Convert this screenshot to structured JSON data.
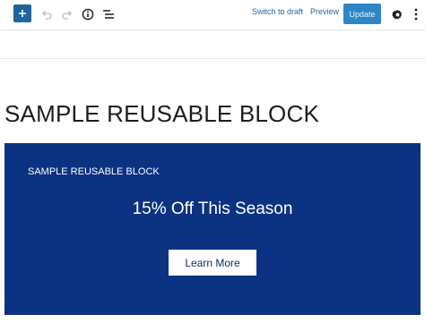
{
  "toolbar": {
    "add_icon": "plus-icon",
    "undo_icon": "undo-icon",
    "redo_icon": "redo-icon",
    "info_icon": "info-icon",
    "outline_icon": "list-view-icon",
    "switch_to_draft_label": "Switch to draft",
    "preview_label": "Preview",
    "update_label": "Update",
    "settings_icon": "gear-icon",
    "more_icon": "more-vertical-icon",
    "colors": {
      "accent": "#1e64a0",
      "update_bg": "#2c86c8"
    }
  },
  "editor": {
    "title": "SAMPLE REUSABLE BLOCK",
    "banner": {
      "label": "SAMPLE REUSABLE BLOCK",
      "offer": "15% Off This Season",
      "cta": "Learn More",
      "background": "#0c3282"
    }
  }
}
